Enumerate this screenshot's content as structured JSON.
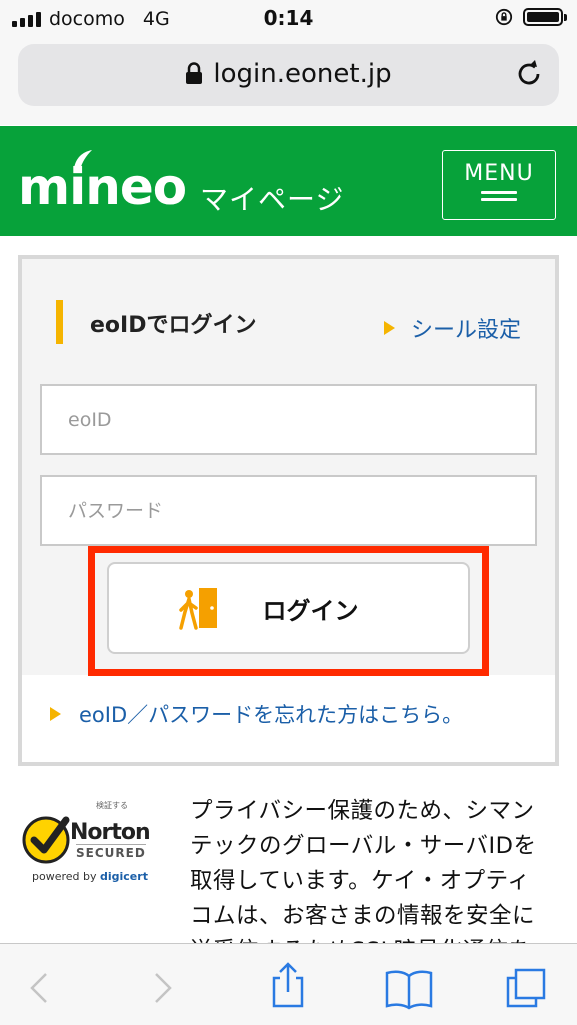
{
  "status_bar": {
    "carrier": "docomo",
    "network": "4G",
    "time": "0:14"
  },
  "browser": {
    "url": "login.eonet.jp"
  },
  "header": {
    "logo": "mineo",
    "subtitle": "マイページ",
    "menu_label": "MENU",
    "brand_color": "#07a23a"
  },
  "login": {
    "title": "eoIDでログイン",
    "seal_link": "シール設定",
    "id_placeholder": "eoID",
    "password_placeholder": "パスワード",
    "button_label": "ログイン",
    "forgot_link": "eoID／パスワードを忘れた方はこちら。",
    "accent_color": "#f5b400",
    "link_color": "#1b5fa8",
    "highlight_color": "#ff2a00"
  },
  "norton": {
    "top_text": "検証する",
    "name": "Norton",
    "secured": "SECURED",
    "powered_by": "powered by",
    "provider": "digicert"
  },
  "privacy_lines": [
    "プライバシー保護のため、シマン",
    "テックのグローバル・サーバIDを",
    "取得しています。ケイ・オプティ",
    "コムは、お客さまの情報を安全に",
    "送受信するためSSL暗号化通信を"
  ],
  "toolbar": {
    "icons": [
      "back-icon",
      "forward-icon",
      "share-icon",
      "bookmarks-icon",
      "tabs-icon"
    ]
  }
}
